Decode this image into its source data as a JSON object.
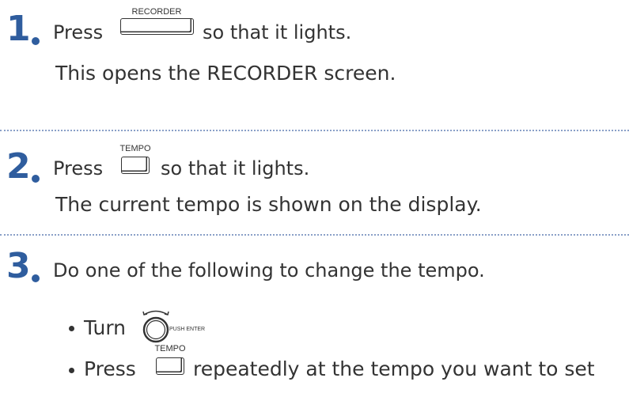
{
  "steps": [
    {
      "number": "1",
      "press": "Press",
      "button_label": "RECORDER",
      "suffix": "so that it lights.",
      "note": "This opens the RECORDER screen."
    },
    {
      "number": "2",
      "press": "Press",
      "button_label": "TEMPO",
      "suffix": "so that it lights.",
      "note": "The current tempo is shown on the display."
    },
    {
      "number": "3",
      "text": "Do one of the following to change the tempo.",
      "options": [
        {
          "text": "Turn",
          "dial_label": "PUSH ENTER"
        },
        {
          "press": "Press",
          "button_label": "TEMPO",
          "suffix": "repeatedly at the tempo you want to set"
        }
      ]
    }
  ],
  "colors": {
    "step_number": "#2f5d9e",
    "text": "#333333",
    "divider": "#8aa0c8"
  }
}
